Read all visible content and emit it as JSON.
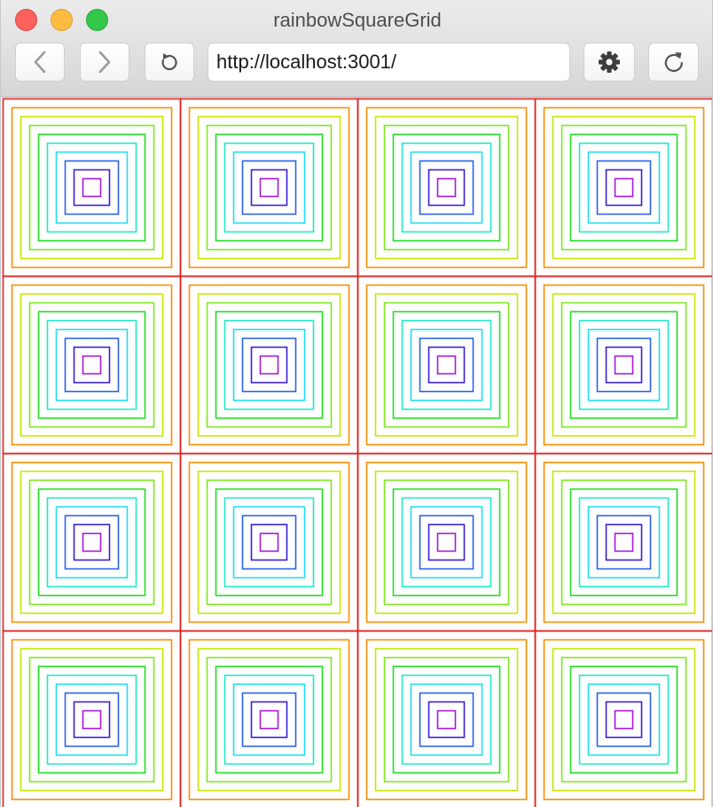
{
  "window": {
    "title": "rainbowSquareGrid"
  },
  "toolbar": {
    "back_icon": "chevron-left-icon",
    "forward_icon": "chevron-right-icon",
    "reload_icon": "reload-icon",
    "settings_icon": "gear-icon",
    "refresh_icon": "refresh-icon",
    "url": "http://localhost:3001/"
  },
  "grid": {
    "rows": 4,
    "cols": 4,
    "cell_border_color": "#e02020",
    "ring_colors": [
      "#ff8c00",
      "#c8e600",
      "#7ee81c",
      "#22dd22",
      "#22e8c8",
      "#22ddf2",
      "#2a62e8",
      "#3a1fd8",
      "#a619d9",
      "#df16dd",
      "#e5148c"
    ]
  }
}
